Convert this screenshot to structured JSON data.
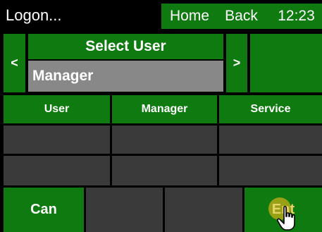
{
  "header": {
    "title": "Logon...",
    "home_label": "Home",
    "back_label": "Back",
    "time": "12:23"
  },
  "selector": {
    "prev_label": "<",
    "title": "Select User",
    "current_user": "Manager",
    "next_label": ">"
  },
  "options": [
    {
      "label": "User"
    },
    {
      "label": "Manager"
    },
    {
      "label": "Service"
    }
  ],
  "footer": {
    "cancel_label": "Can",
    "enter_label": "Ent"
  },
  "colors": {
    "panel_green": "#0f7a10",
    "empty_cell": "#3a3a3a",
    "field_gray": "#888888",
    "background": "#000000"
  },
  "icons": {
    "cursor": "hand-pointer-icon"
  }
}
